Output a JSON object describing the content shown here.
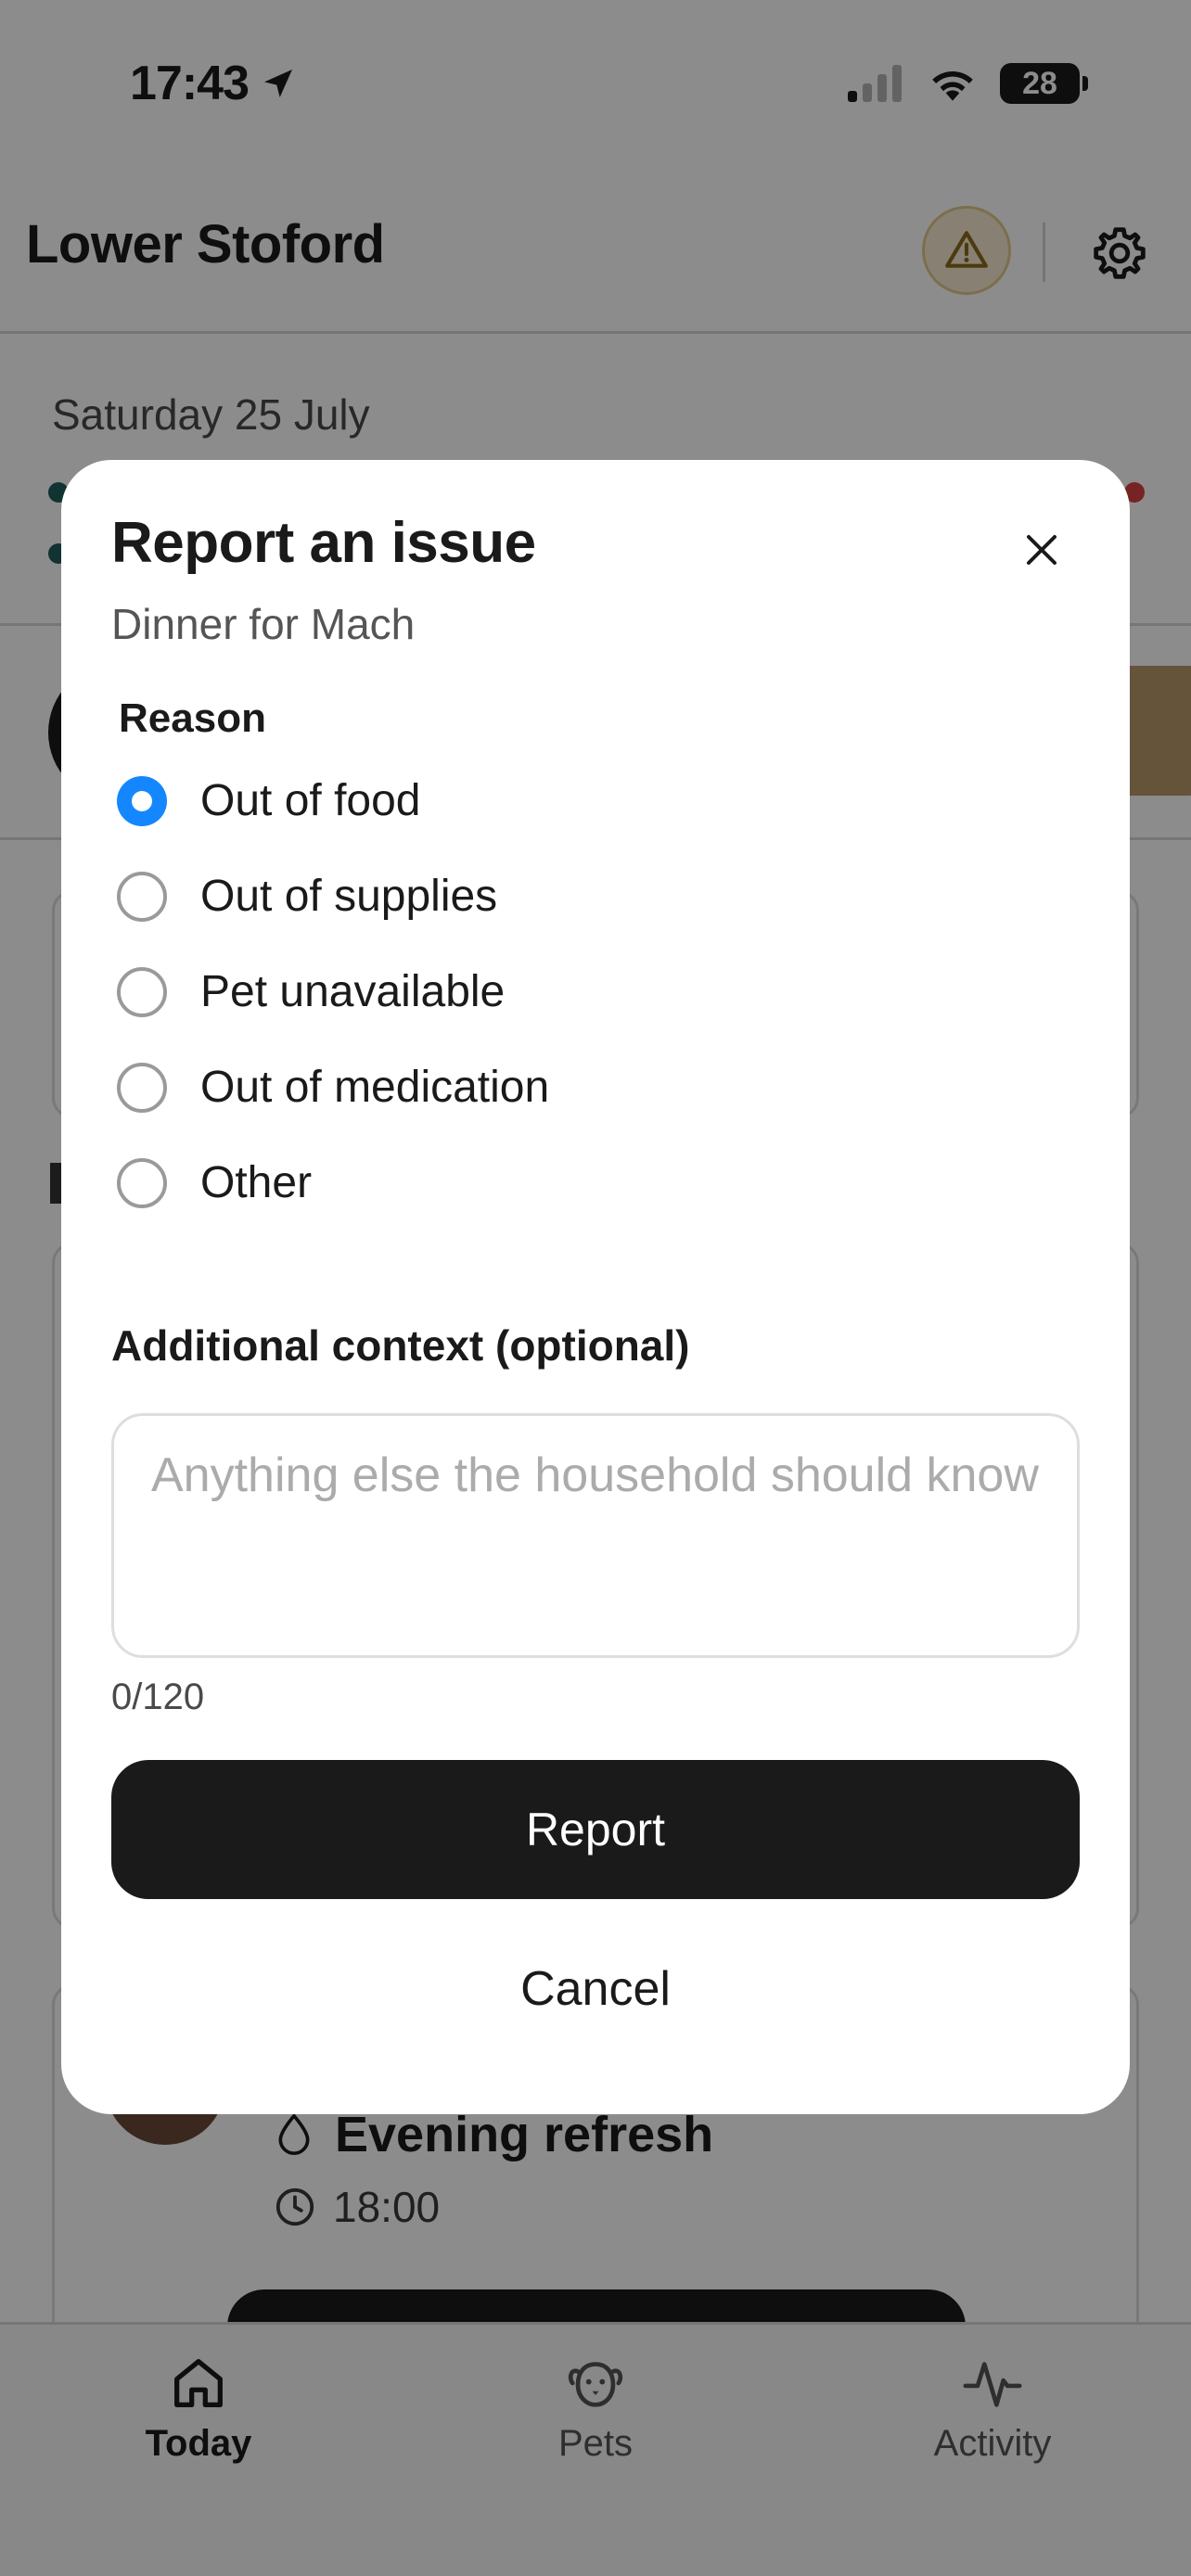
{
  "status_bar": {
    "time": "17:43",
    "battery": "28",
    "icons": [
      "location-arrow-icon",
      "cellular-signal-icon",
      "wifi-icon",
      "battery-icon"
    ]
  },
  "header": {
    "title": "Lower Stoford",
    "alert_icon": "warning-triangle-icon",
    "settings_icon": "gear-icon"
  },
  "background": {
    "date": "Saturday 25 July",
    "evening_task": {
      "title": "Evening refresh",
      "time": "18:00"
    }
  },
  "modal": {
    "title": "Report an issue",
    "subtitle": "Dinner for Mach",
    "reason_label": "Reason",
    "options": [
      {
        "label": "Out of food",
        "selected": true
      },
      {
        "label": "Out of supplies",
        "selected": false
      },
      {
        "label": "Pet unavailable",
        "selected": false
      },
      {
        "label": "Out of medication",
        "selected": false
      },
      {
        "label": "Other",
        "selected": false
      }
    ],
    "context_label": "Additional context (optional)",
    "context_placeholder": "Anything else the household should know",
    "context_value": "",
    "char_count": "0/120",
    "report_label": "Report",
    "cancel_label": "Cancel"
  },
  "tab_bar": {
    "tabs": [
      {
        "label": "Today",
        "icon": "home-icon",
        "active": true
      },
      {
        "label": "Pets",
        "icon": "dog-face-icon",
        "active": false
      },
      {
        "label": "Activity",
        "icon": "activity-pulse-icon",
        "active": false
      }
    ]
  },
  "colors": {
    "accent": "#1487ff",
    "primary_button": "#1a1a1a",
    "alert_background": "#f7ecd1"
  }
}
